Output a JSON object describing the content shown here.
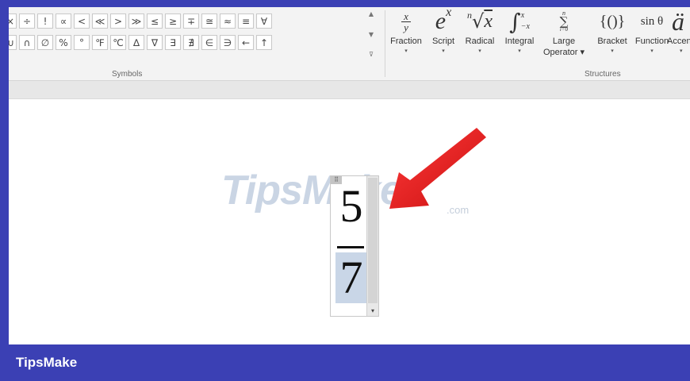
{
  "ribbon": {
    "symbols": {
      "group_label": "Symbols",
      "row1": [
        "×",
        "÷",
        "!",
        "∝",
        "<",
        "≪",
        ">",
        "≫",
        "≤",
        "≥",
        "∓",
        "≅",
        "≈",
        "≡",
        "∀"
      ],
      "row2": [
        "∪",
        "∩",
        "∅",
        "%",
        "°",
        "℉",
        "℃",
        "∆",
        "∇",
        "∃",
        "∄",
        "∈",
        "∋",
        "←",
        "↑"
      ],
      "scroll_up": "▲",
      "scroll_down": "▼",
      "more": "⊽"
    },
    "structures": {
      "group_label": "Structures",
      "items": [
        {
          "label": "Fraction",
          "icon": "fraction-icon",
          "arrow": "▾"
        },
        {
          "label": "Script",
          "icon": "script-icon",
          "arrow": "▾"
        },
        {
          "label": "Radical",
          "icon": "radical-icon",
          "arrow": "▾"
        },
        {
          "label": "Integral",
          "icon": "integral-icon",
          "arrow": "▾"
        },
        {
          "label": "Large",
          "label2": "Operator ▾",
          "icon": "large-operator-icon"
        },
        {
          "label": "Bracket",
          "icon": "bracket-icon",
          "arrow": "▾"
        },
        {
          "label": "Function",
          "icon": "function-icon",
          "arrow": "▾"
        },
        {
          "label": "Accen",
          "icon": "accent-icon",
          "arrow": "▾"
        }
      ],
      "glyphs": {
        "fraction_num": "x",
        "fraction_den": "y",
        "script_base": "e",
        "script_sup": "x",
        "radical_index": "n",
        "radical_sign": "√",
        "radical_body": "x",
        "integral_sign": "∫",
        "integral_upper": "x",
        "integral_lower": "−x",
        "large_op_upper": "n",
        "large_op_sign": "∑",
        "large_op_lower": "i=0",
        "bracket": "{()}",
        "function": "sin θ",
        "accent": "ä"
      }
    }
  },
  "document": {
    "watermark": "TipsMake",
    "watermark_suffix": ".com",
    "equation": {
      "numerator": "5",
      "denominator": "7",
      "handle": "⠿",
      "scroll_arrow": "▾"
    }
  },
  "footer": {
    "brand": "TipsMake"
  },
  "colors": {
    "frame_border": "#3b40b4",
    "arrow": "#e01b1b",
    "selection": "#c9d6e7"
  }
}
